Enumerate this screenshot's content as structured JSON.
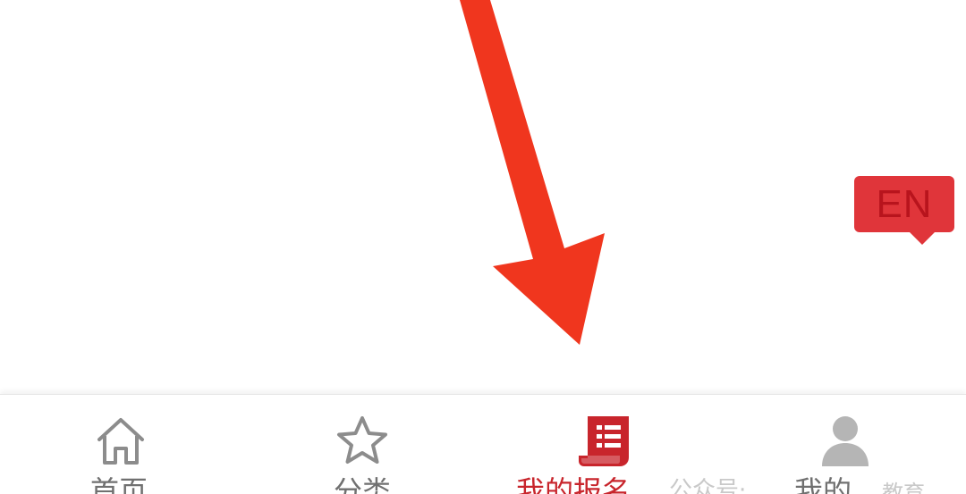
{
  "language_badge": {
    "label": "EN",
    "color": "#e0353a"
  },
  "annotation": {
    "icon": "arrow-pointing-down-icon",
    "color": "#f0361e"
  },
  "tabbar": {
    "active_color": "#c8252c",
    "inactive_color": "#707070",
    "items": [
      {
        "label": "首页",
        "icon": "home-icon",
        "active": false
      },
      {
        "label": "分类",
        "icon": "star-icon",
        "active": false
      },
      {
        "label": "我的报名",
        "icon": "document-list-icon",
        "active": true
      },
      {
        "label": "我的",
        "icon": "person-icon",
        "active": false
      }
    ]
  },
  "watermark": {
    "left_text": "公众号·",
    "right_text": "教育"
  }
}
